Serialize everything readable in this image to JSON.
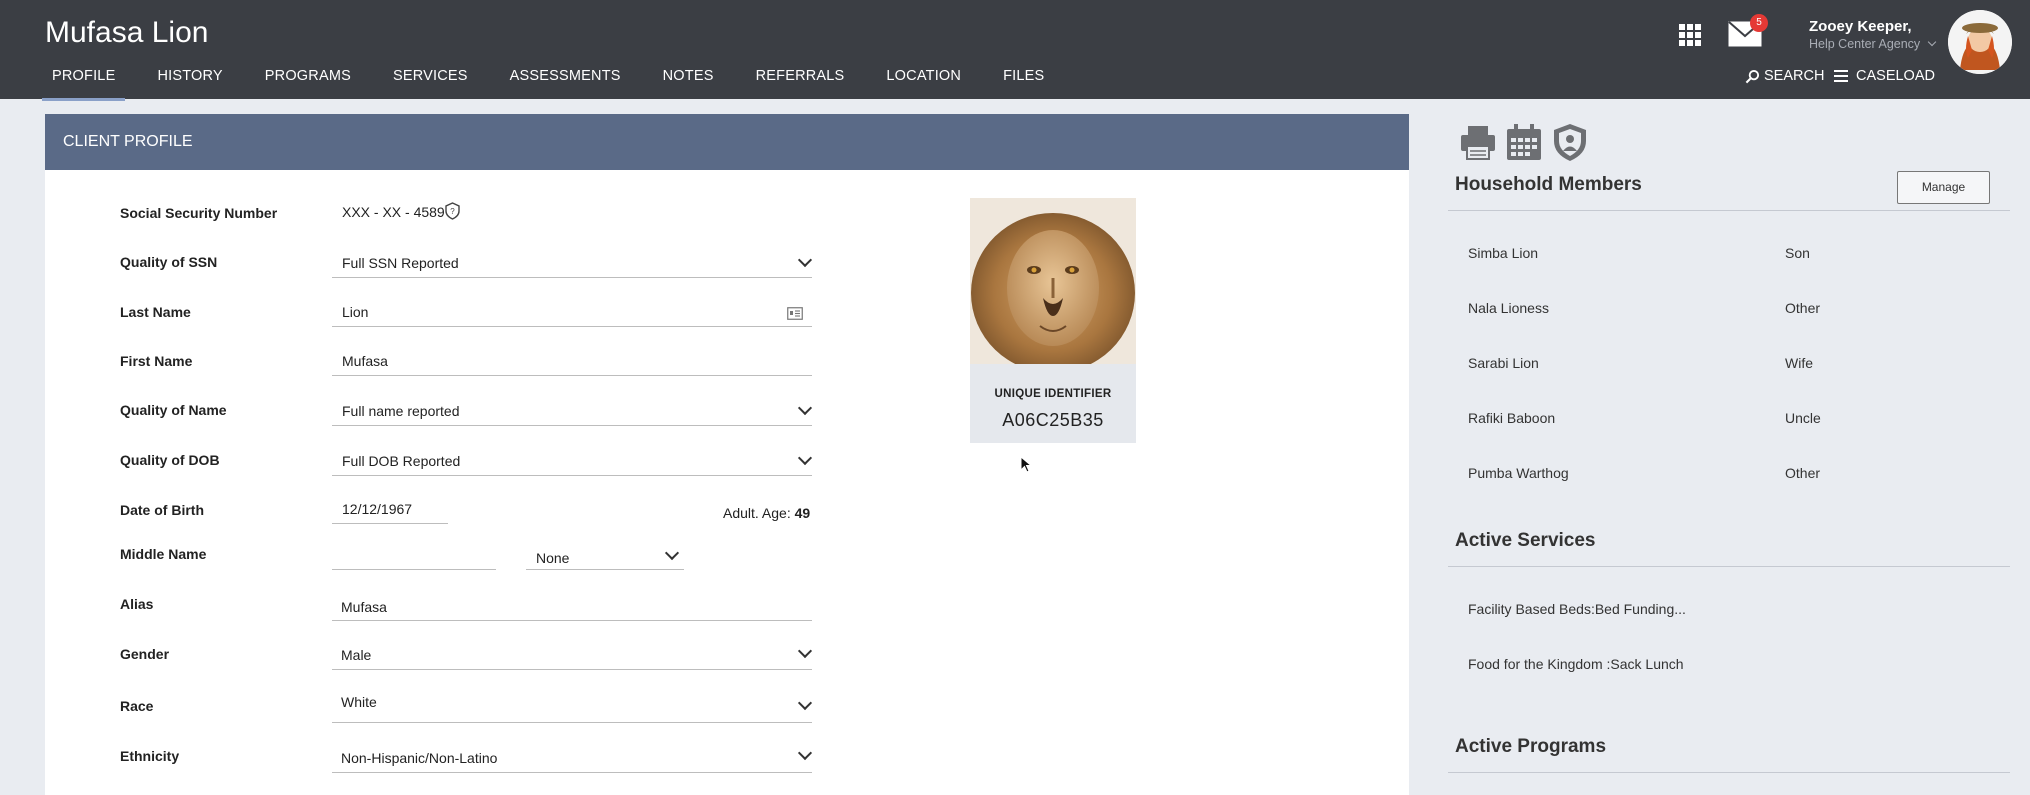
{
  "header": {
    "client_name": "Mufasa Lion",
    "nav": [
      "PROFILE",
      "HISTORY",
      "PROGRAMS",
      "SERVICES",
      "ASSESSMENTS",
      "NOTES",
      "REFERRALS",
      "LOCATION",
      "FILES"
    ],
    "nav_active": "PROFILE",
    "search_label": "SEARCH",
    "caseload_label": "CASELOAD",
    "mail_count": "5",
    "user_name": "Zooey Keeper,",
    "user_agency": "Help Center Agency"
  },
  "profile": {
    "panel_title": "CLIENT PROFILE",
    "ssn_label": "Social Security Number",
    "ssn_value": "XXX - XX - 4589",
    "ssn_quality_label": "Quality of SSN",
    "ssn_quality_value": "Full SSN Reported",
    "last_name_label": "Last Name",
    "last_name_value": "Lion",
    "first_name_label": "First Name",
    "first_name_value": "Mufasa",
    "name_quality_label": "Quality of Name",
    "name_quality_value": "Full name reported",
    "dob_quality_label": "Quality of DOB",
    "dob_quality_value": "Full DOB Reported",
    "dob_label": "Date of Birth",
    "dob_value": "12/12/1967",
    "age_text": "Adult. Age:",
    "age_value": "49",
    "middle_name_label": "Middle Name",
    "middle_name_value": "",
    "suffix_value": "None",
    "alias_label": "Alias",
    "alias_value": "Mufasa",
    "gender_label": "Gender",
    "gender_value": "Male",
    "race_label": "Race",
    "race_value": "White",
    "ethnicity_label": "Ethnicity",
    "ethnicity_value": "Non-Hispanic/Non-Latino",
    "uid_label": "UNIQUE IDENTIFIER",
    "uid_value": "A06C25B35"
  },
  "sidebar": {
    "household_title": "Household Members",
    "manage_label": "Manage",
    "members": [
      {
        "name": "Simba Lion",
        "relation": "Son"
      },
      {
        "name": "Nala Lioness",
        "relation": "Other"
      },
      {
        "name": "Sarabi Lion",
        "relation": "Wife"
      },
      {
        "name": "Rafiki Baboon",
        "relation": "Uncle"
      },
      {
        "name": "Pumba Warthog",
        "relation": "Other"
      }
    ],
    "services_title": "Active Services",
    "services": [
      "Facility Based Beds:Bed Funding...",
      "Food for the Kingdom :Sack Lunch"
    ],
    "programs_title": "Active Programs"
  },
  "colors": {
    "topbar": "#3b3e44",
    "panel_header": "#5a6a87",
    "badge": "#e53935",
    "page_bg": "#e9ecf1"
  }
}
